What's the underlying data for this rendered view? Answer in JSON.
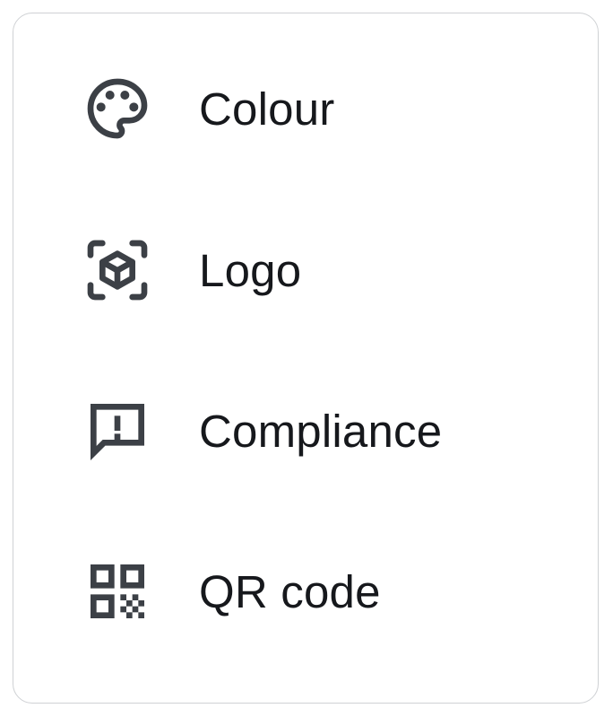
{
  "menu": {
    "items": [
      {
        "label": "Colour",
        "icon": "palette-icon"
      },
      {
        "label": "Logo",
        "icon": "cube-focus-icon"
      },
      {
        "label": "Compliance",
        "icon": "feedback-alert-icon"
      },
      {
        "label": "QR code",
        "icon": "qr-code-icon"
      }
    ]
  },
  "colors": {
    "icon": "#3c4046",
    "text": "#16181c",
    "border": "#cfd1d4"
  }
}
